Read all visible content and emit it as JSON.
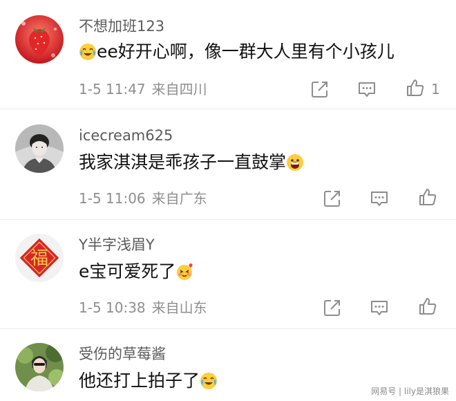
{
  "comments": [
    {
      "username": "不想加班123",
      "lead_emoji": "laugh-cry-emoji",
      "text": "ee好开心啊，像一群大人里有个小孩儿",
      "time": "1-5 11:47",
      "location": "来自四川",
      "likes": "1",
      "avatar": "strawberry-avatar"
    },
    {
      "username": "icecream625",
      "text": "我家淇淇是乖孩子一直鼓掌",
      "trail_emoji": "grin-emoji",
      "time": "1-5 11:06",
      "location": "来自广东",
      "avatar": "person-photo-avatar"
    },
    {
      "username": "Y半字浅眉Y",
      "text": "e宝可爱死了",
      "trail_emoji": "love-face-emoji",
      "time": "1-5 10:38",
      "location": "来自山东",
      "avatar": "fu-character-avatar",
      "avatar_char": "福"
    },
    {
      "username": "受伤的草莓酱",
      "text": "他还打上拍子了",
      "trail_emoji": "laugh-cry-emoji",
      "avatar": "person-green-avatar"
    }
  ],
  "watermark": "网易号 | lily是淇狼果",
  "colors": {
    "meta": "#8e8e8e",
    "icon": "#8c8c8c",
    "fu_red": "#d8262b"
  }
}
